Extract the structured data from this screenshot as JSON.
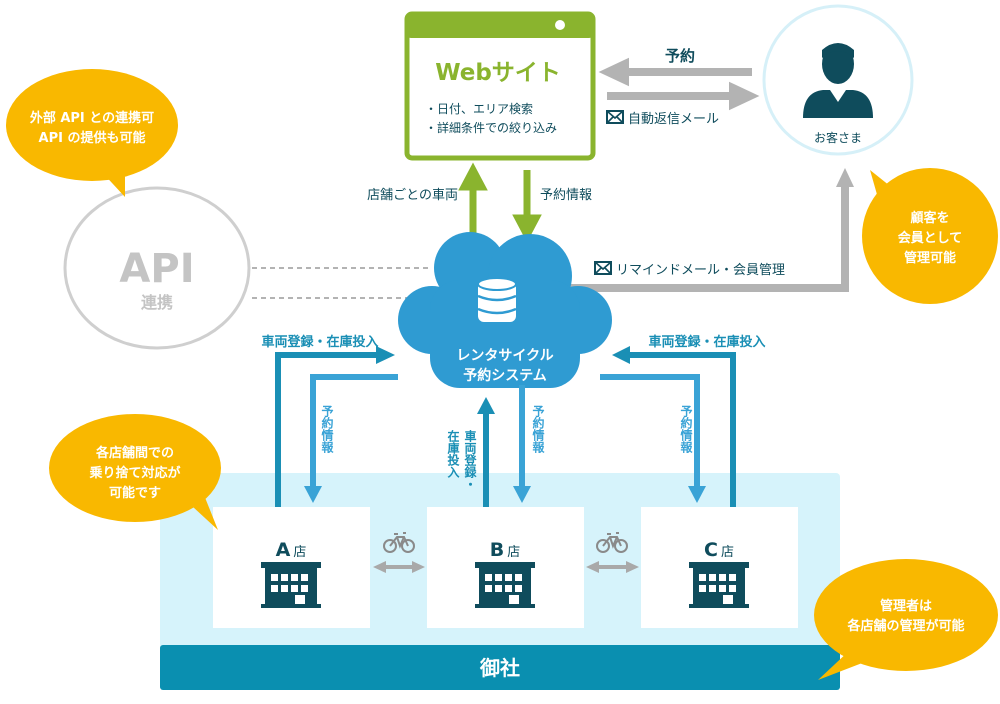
{
  "colors": {
    "green": "#8ab42e",
    "teal_dark": "#0f4c5c",
    "blue": "#1a8fb5",
    "blue_light": "#3aa3d6",
    "cloud": "#2f9bd2",
    "light_bg": "#d6f3fb",
    "band": "#0a8fb0",
    "yellow": "#f9b800",
    "gray": "#b3b3b3"
  },
  "website": {
    "title": "Webサイト",
    "bullets": [
      "・日付、エリア検索",
      "・詳細条件での絞り込み"
    ]
  },
  "customer": {
    "label": "お客さま",
    "reserve_label": "予約",
    "auto_reply_label": "自動返信メール"
  },
  "web_links": {
    "vehicles_label": "店舗ごとの車両",
    "reservation_info_label": "予約情報"
  },
  "api": {
    "title": "API",
    "subtitle": "連携"
  },
  "bubbles": {
    "api": [
      "外部 API との連携可",
      "API の提供も可能"
    ],
    "members": [
      "顧客を",
      "会員として",
      "管理可能"
    ],
    "stores": [
      "各店舗間での",
      "乗り捨て対応が",
      "可能です"
    ],
    "admin": [
      "管理者は",
      "各店舗の管理が可能"
    ]
  },
  "system": {
    "line1": "レンタサイクル",
    "line2": "予約システム",
    "remind_label": "リマインドメール・会員管理"
  },
  "flows": {
    "register": "車両登録・在庫投入",
    "reservation": "予約情報",
    "register_v1": "車両登録・",
    "register_v2": "在庫投入"
  },
  "stores": [
    {
      "letter": "A",
      "suffix": "店"
    },
    {
      "letter": "B",
      "suffix": "店"
    },
    {
      "letter": "C",
      "suffix": "店"
    }
  ],
  "company": {
    "label": "御社"
  }
}
